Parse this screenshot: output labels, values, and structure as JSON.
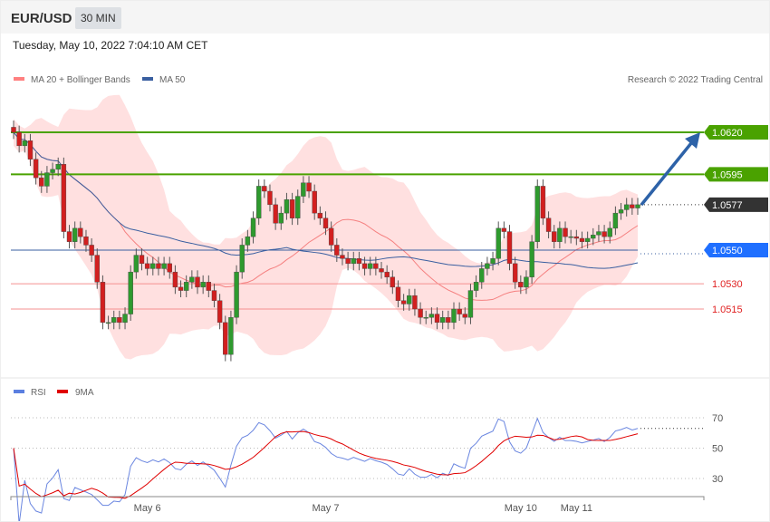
{
  "header": {
    "symbol": "EUR/USD",
    "timeframe": "30 MIN",
    "timestamp": "Tuesday, May 10, 2022 7:04:10 AM CET"
  },
  "legend": {
    "ma20": "MA 20 + Bollinger Bands",
    "ma50": "MA 50",
    "copyright": "Research © 2022 Trading Central",
    "rsi": "RSI",
    "rsi_ma": "9MA"
  },
  "colors": {
    "up": "#2e9a2e",
    "down": "#d21f1f",
    "band": "#ffe0e0",
    "ma20": "#f58080",
    "ma50": "#3a5fa0",
    "green": "#4aa200",
    "blue": "#1f6fff",
    "red": "#e02020"
  },
  "chart_data": [
    {
      "type": "candlestick",
      "title": "EUR/USD 30 MIN",
      "ylim": [
        1.0475,
        1.064
      ],
      "levels": [
        {
          "label": "1.0620",
          "value": 1.062,
          "kind": "resistance"
        },
        {
          "label": "1.0595",
          "value": 1.0595,
          "kind": "resistance"
        },
        {
          "label": "1.0577",
          "value": 1.0577,
          "kind": "last"
        },
        {
          "label": "1.0550",
          "value": 1.055,
          "kind": "pivot"
        },
        {
          "label": "1.0530",
          "value": 1.053,
          "kind": "support"
        },
        {
          "label": "1.0515",
          "value": 1.0515,
          "kind": "support"
        }
      ],
      "x_labels": [
        {
          "label": "May 6",
          "index": 24
        },
        {
          "label": "May 7",
          "index": 56
        },
        {
          "label": "May 10",
          "index": 91
        },
        {
          "label": "May 11",
          "index": 101
        }
      ],
      "closes": [
        1.062,
        1.0612,
        1.0615,
        1.0604,
        1.0593,
        1.0588,
        1.0596,
        1.0598,
        1.0601,
        1.0561,
        1.0555,
        1.0563,
        1.0558,
        1.0553,
        1.0547,
        1.0531,
        1.0507,
        1.0507,
        1.051,
        1.0507,
        1.0512,
        1.0537,
        1.0547,
        1.0542,
        1.0539,
        1.0542,
        1.0539,
        1.0542,
        1.0537,
        1.0528,
        1.0526,
        1.0531,
        1.0534,
        1.0528,
        1.0531,
        1.0526,
        1.052,
        1.0507,
        1.0488,
        1.051,
        1.0537,
        1.0553,
        1.0558,
        1.0569,
        1.0588,
        1.0585,
        1.0577,
        1.0566,
        1.0572,
        1.058,
        1.0569,
        1.0582,
        1.059,
        1.0585,
        1.0572,
        1.0569,
        1.0563,
        1.0553,
        1.0547,
        1.0545,
        1.0542,
        1.0545,
        1.0542,
        1.0539,
        1.0542,
        1.0539,
        1.0537,
        1.0534,
        1.0528,
        1.052,
        1.0518,
        1.0523,
        1.0515,
        1.051,
        1.051,
        1.0512,
        1.0507,
        1.051,
        1.0507,
        1.0515,
        1.0512,
        1.051,
        1.0526,
        1.0531,
        1.0539,
        1.0542,
        1.0545,
        1.0563,
        1.0561,
        1.0542,
        1.0531,
        1.0528,
        1.0534,
        1.0555,
        1.0588,
        1.0569,
        1.0561,
        1.0555,
        1.0563,
        1.0558,
        1.0558,
        1.0557,
        1.0555,
        1.0557,
        1.0559,
        1.0561,
        1.0558,
        1.0563,
        1.0572,
        1.0574,
        1.0577,
        1.0575,
        1.0577
      ]
    },
    {
      "type": "line",
      "title": "RSI",
      "ylim": [
        20,
        80
      ],
      "ticks": [
        "70",
        "50",
        "30"
      ]
    }
  ]
}
